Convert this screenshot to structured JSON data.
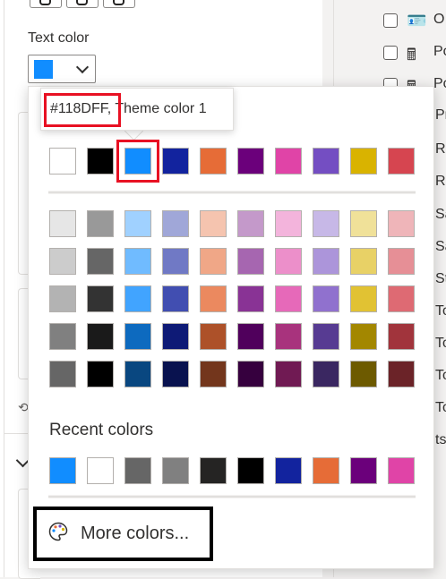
{
  "format_pane": {
    "text_color_label": "Text color",
    "selected_color": "#118DFF"
  },
  "fields_list": [
    {
      "text": "O",
      "icon": "card-icon"
    },
    {
      "text": "Po",
      "icon": "calculator-icon"
    },
    {
      "text": "Po",
      "icon": "calculator-icon"
    },
    {
      "text": "Pr",
      "icon": ""
    },
    {
      "text": "Re",
      "icon": ""
    },
    {
      "text": "Re",
      "icon": ""
    },
    {
      "text": "Sa",
      "icon": ""
    },
    {
      "text": "Sa",
      "icon": ""
    },
    {
      "text": "St",
      "icon": ""
    },
    {
      "text": "To",
      "icon": ""
    },
    {
      "text": "To",
      "icon": ""
    },
    {
      "text": "To",
      "icon": ""
    },
    {
      "text": "To",
      "icon": ""
    },
    {
      "text": "ts",
      "icon": ""
    }
  ],
  "color_picker": {
    "tooltip_hex": "#118DFF",
    "tooltip_rest": ", Theme color 1",
    "theme_colors": [
      "#FFFFFF",
      "#000000",
      "#118DFF",
      "#12239E",
      "#E66C37",
      "#6B007B",
      "#E044A7",
      "#744EC2",
      "#D9B300",
      "#D64550"
    ],
    "shades": [
      [
        "#E6E6E6",
        "#999999",
        "#A0D1FF",
        "#A0A7D8",
        "#F5C4AF",
        "#C499CA",
        "#F3B4DC",
        "#C7B8E7",
        "#F0E199",
        "#EFB5B9"
      ],
      [
        "#CCCCCC",
        "#666666",
        "#70BBFF",
        "#7079C5",
        "#F0A787",
        "#A666B0",
        "#EC8FCA",
        "#AC95DA",
        "#E8D166",
        "#E68F96"
      ],
      [
        "#B3B3B3",
        "#333333",
        "#41A4FF",
        "#414EB1",
        "#EB895F",
        "#893395",
        "#E669B9",
        "#9071CE",
        "#E1C233",
        "#DE6A73"
      ],
      [
        "#808080",
        "#1A1A1A",
        "#0D6ABF",
        "#0E1A76",
        "#AD5129",
        "#50005C",
        "#A8337D",
        "#573B92",
        "#A38700",
        "#A1343C"
      ],
      [
        "#666666",
        "#000000",
        "#094780",
        "#09124F",
        "#73361C",
        "#36003E",
        "#701A53",
        "#3A2761",
        "#6D5A00",
        "#6B2328"
      ]
    ],
    "recent_title": "Recent colors",
    "recent_colors": [
      "#118DFF",
      "#FFFFFF",
      "#666666",
      "#808080",
      "#252423",
      "#000000",
      "#12239E",
      "#E66C37",
      "#6B007B",
      "#E044A7"
    ],
    "more_colors_label": "More colors..."
  }
}
